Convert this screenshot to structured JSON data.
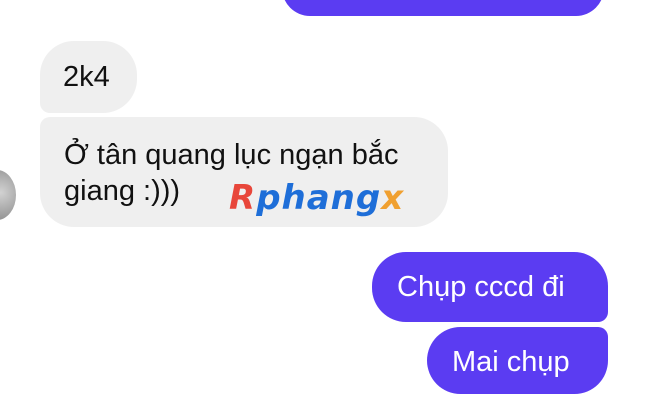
{
  "messages": {
    "incoming": [
      {
        "text": "2k4"
      },
      {
        "line1": "Ở tân quang lục ngạn bắc",
        "line2": "giang :)))"
      }
    ],
    "outgoing": [
      {
        "text": "Chụp cccd đi"
      },
      {
        "text": "Mai chụp"
      }
    ]
  },
  "watermark": {
    "r": "R",
    "mid": "phang",
    "x": "x"
  },
  "colors": {
    "outgoing_bubble": "#5b3cf2",
    "incoming_bubble": "#efefef"
  }
}
